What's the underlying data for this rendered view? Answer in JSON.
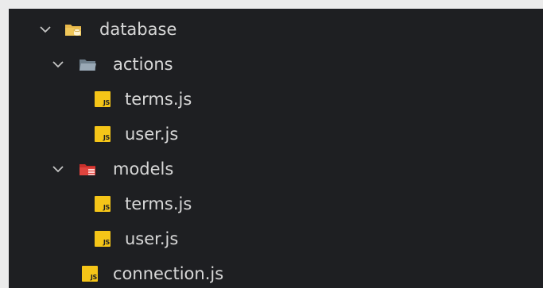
{
  "tree": {
    "database": {
      "label": "database",
      "icon": "database-folder-icon",
      "expanded": true,
      "children": {
        "actions": {
          "label": "actions",
          "icon": "folder-open-icon",
          "expanded": true,
          "files": [
            "terms.js",
            "user.js"
          ]
        },
        "models": {
          "label": "models",
          "icon": "models-folder-icon",
          "expanded": true,
          "files": [
            "terms.js",
            "user.js"
          ]
        },
        "connection": {
          "label": "connection.js"
        }
      }
    },
    "file_badge": "JS"
  },
  "colors": {
    "panel_bg": "#1e1f22",
    "page_bg": "#ebebeb",
    "text": "#d8d8d8",
    "chevron": "#c5c5c5",
    "js_badge": "#f5c518",
    "db_folder": "#e8b84a",
    "plain_folder": "#8a9aa8",
    "models_folder": "#e0443e"
  }
}
